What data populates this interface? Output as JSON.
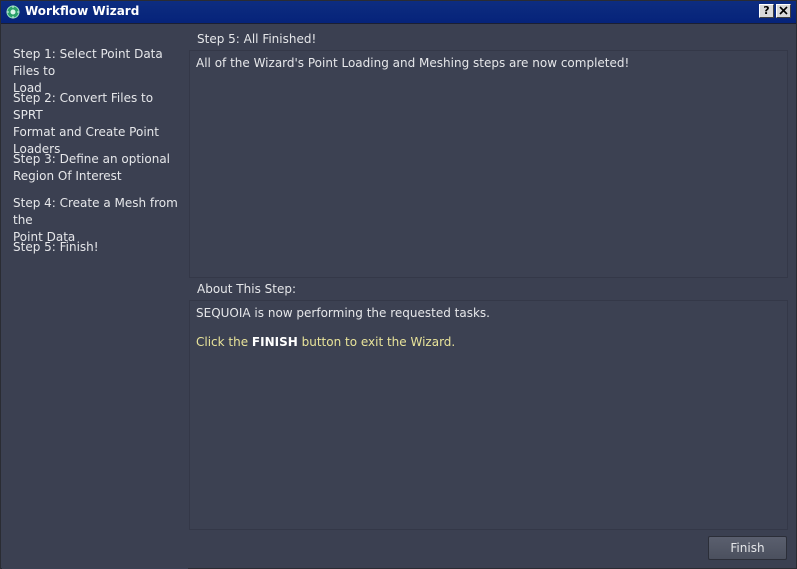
{
  "window": {
    "title": "Workflow Wizard",
    "help_label": "?",
    "close_label": "X"
  },
  "sidebar": {
    "steps": [
      {
        "label_l1": "Step 1: Select Point Data Files to",
        "label_l2": "Load"
      },
      {
        "label_l1": "Step 2: Convert Files to SPRT",
        "label_l2": "Format and Create Point",
        "label_l3": "Loaders"
      },
      {
        "label_l1": "Step 3: Define an optional",
        "label_l2": "Region Of Interest"
      },
      {
        "label_l1": "Step 4: Create a Mesh from the",
        "label_l2": "Point Data"
      },
      {
        "label_l1": "Step 5: Finish!"
      }
    ]
  },
  "main": {
    "step_title": "Step 5: All Finished!",
    "step_message": "All of the Wizard's Point Loading and Meshing steps are now completed!",
    "about_title": "About This Step:",
    "about_line1": "SEQUOIA is now performing the requested tasks.",
    "about_line2_pre": "Click the ",
    "about_line2_bold": "FINISH",
    "about_line2_post": " button to exit the Wizard."
  },
  "footer": {
    "finish_label": "Finish"
  },
  "colors": {
    "titlebar": "#0d2d80",
    "background": "#3b4051",
    "highlight_text": "#e8e39a"
  }
}
